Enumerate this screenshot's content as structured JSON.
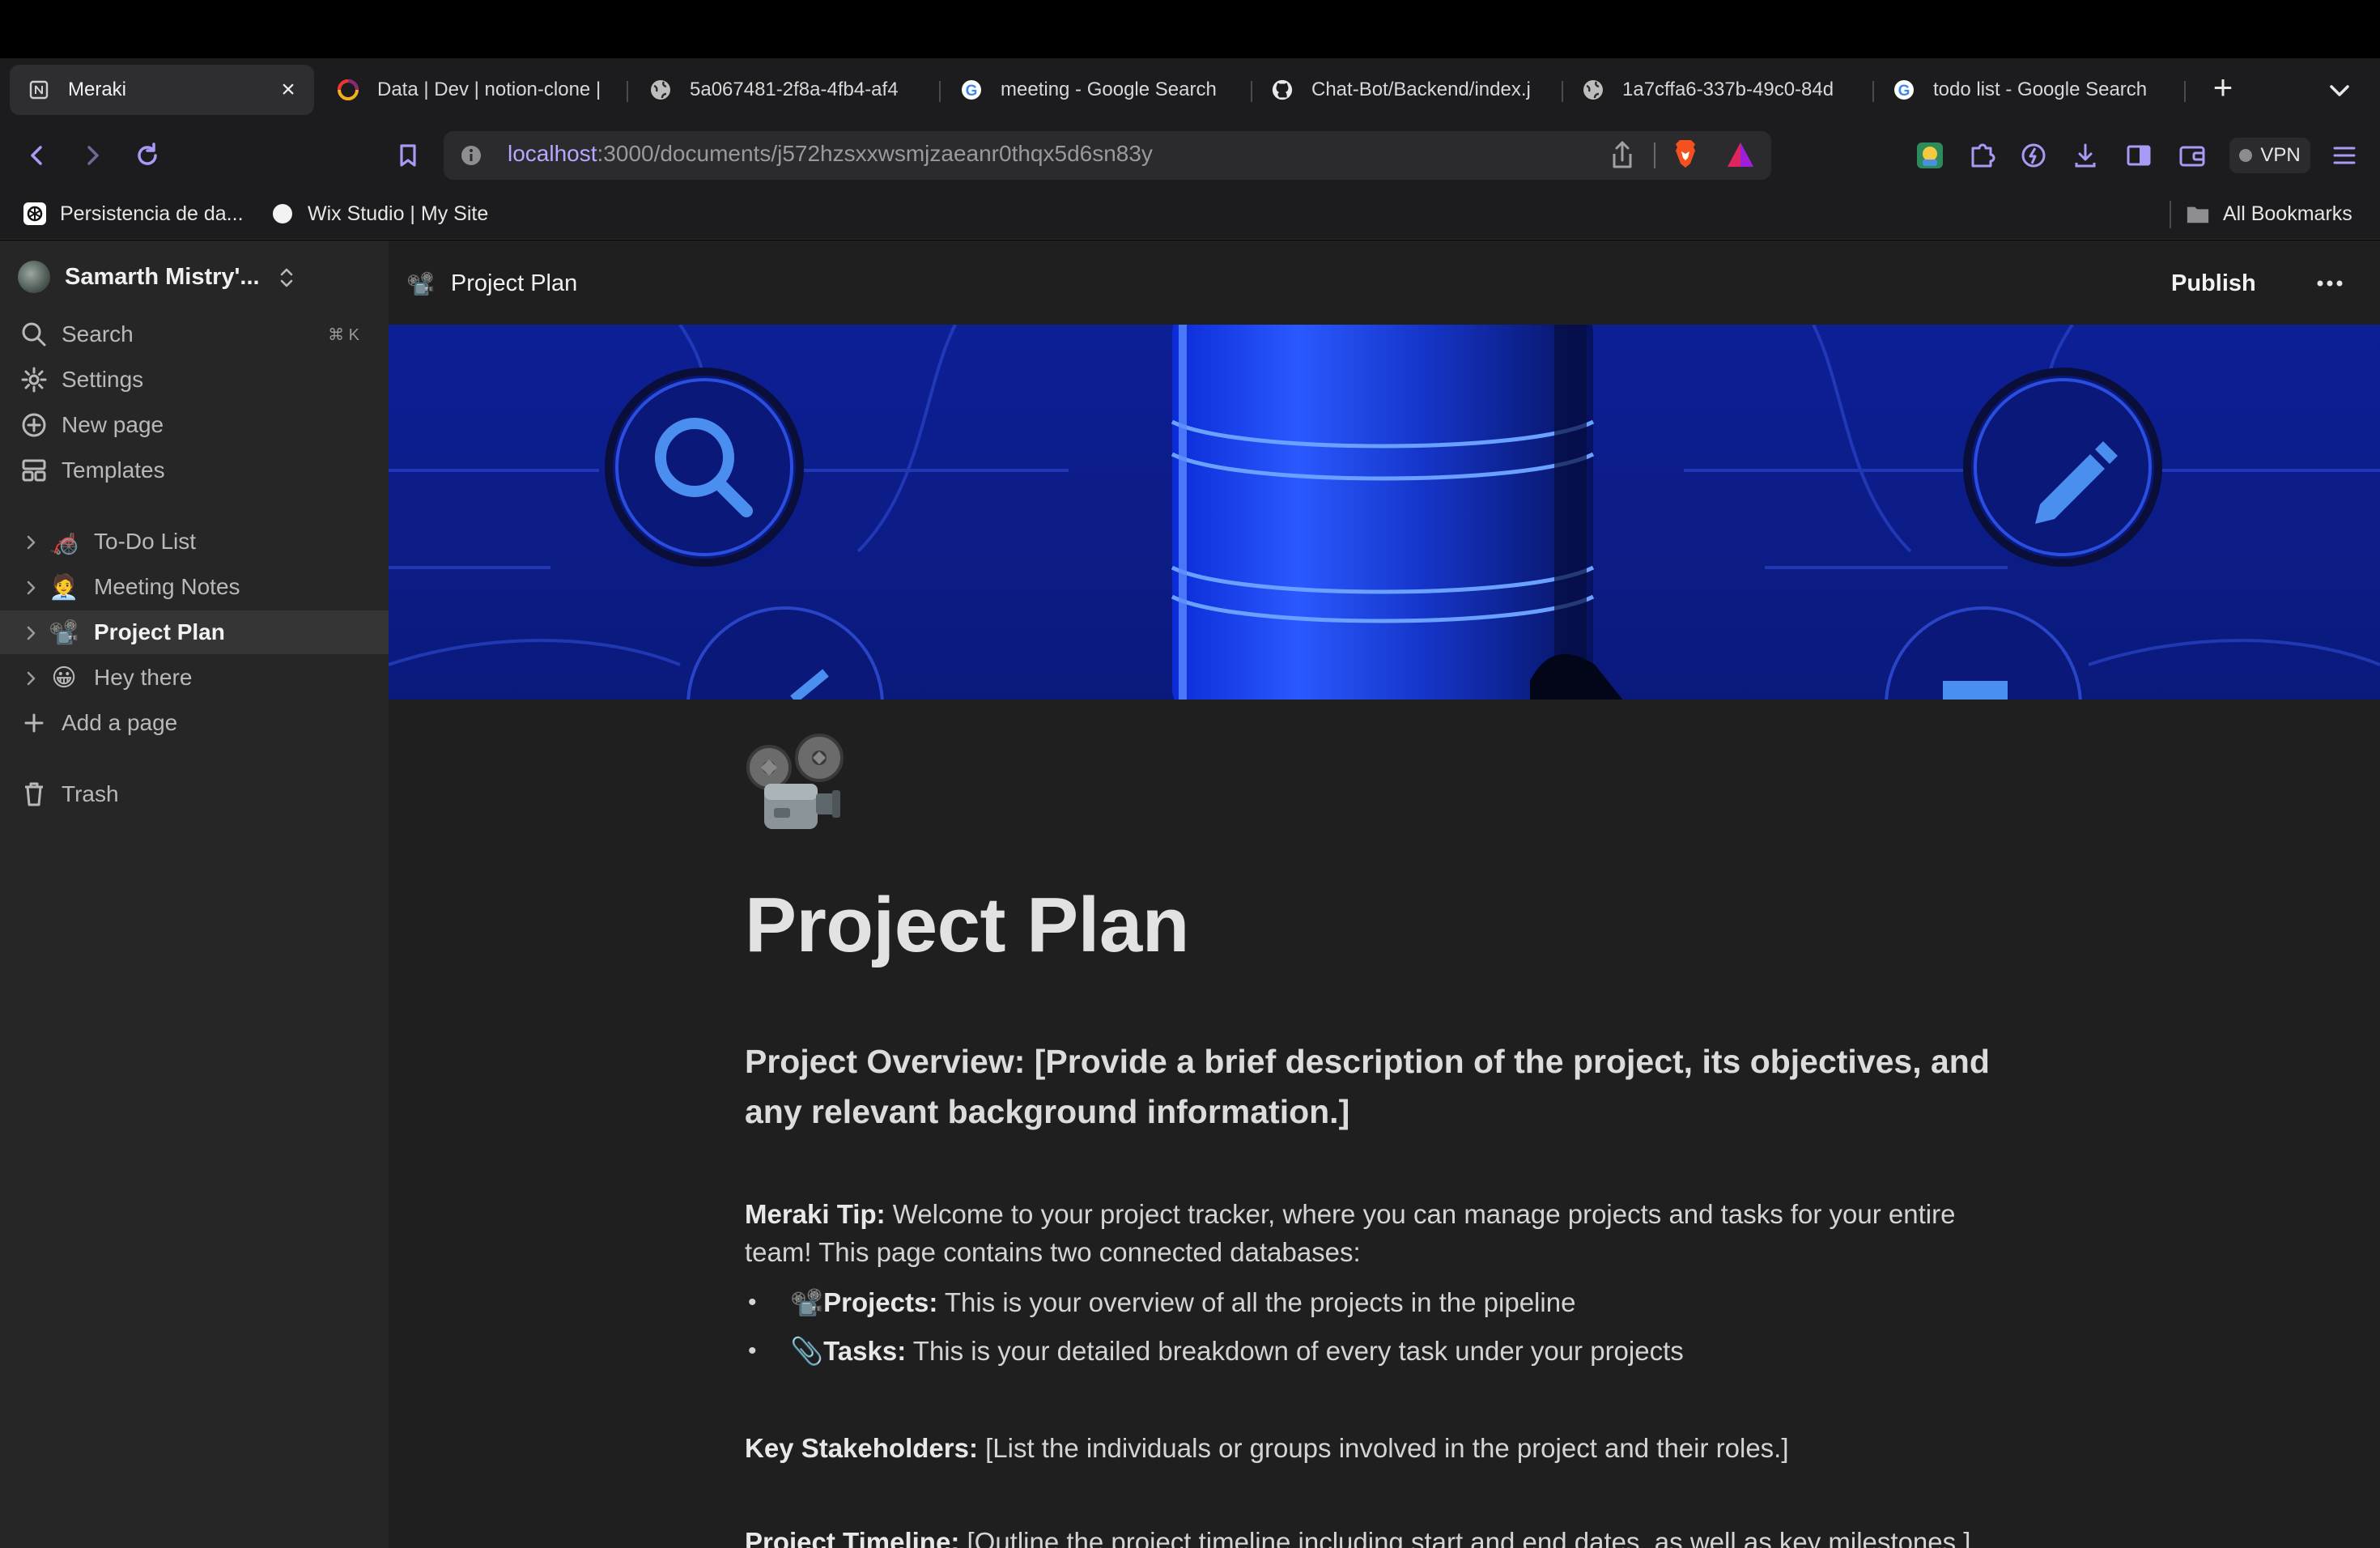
{
  "browser": {
    "tabs": [
      {
        "title": "Meraki",
        "icon": "notion-page-icon",
        "active": true
      },
      {
        "title": "Data | Dev | notion-clone |",
        "icon": "convex-logo-icon"
      },
      {
        "title": "5a067481-2f8a-4fb4-af4",
        "icon": "globe-icon"
      },
      {
        "title": "meeting - Google Search",
        "icon": "google-icon"
      },
      {
        "title": "Chat-Bot/Backend/index.j",
        "icon": "github-icon"
      },
      {
        "title": "1a7cffa6-337b-49c0-84d",
        "icon": "globe-icon"
      },
      {
        "title": "todo list - Google Search",
        "icon": "google-icon"
      }
    ],
    "close_tab": "×",
    "new_tab": "+",
    "url_host": "localhost",
    "url_path": ":3000/documents/j572hzsxxwsmjzaeanr0thqx5d6sn83y",
    "vpn_label": "VPN",
    "bookmarks": [
      {
        "label": "Persistencia de da...",
        "icon": "openai-icon"
      },
      {
        "label": "Wix Studio | My Site",
        "icon": "wix-circle-icon"
      }
    ],
    "all_bookmarks": "All Bookmarks",
    "accent": "#b9a6ff"
  },
  "sidebar": {
    "workspace_name": "Samarth Mistry'...",
    "actions": [
      {
        "label": "Search",
        "icon": "search-icon",
        "shortcut": "⌘ K"
      },
      {
        "label": "Settings",
        "icon": "gear-icon"
      },
      {
        "label": "New page",
        "icon": "plus-circle-icon"
      },
      {
        "label": "Templates",
        "icon": "templates-icon"
      }
    ],
    "documents": [
      {
        "label": "To-Do List",
        "emoji": "🦽"
      },
      {
        "label": "Meeting Notes",
        "emoji": "🧑‍💼"
      },
      {
        "label": "Project Plan",
        "emoji": "📽️",
        "selected": true
      },
      {
        "label": "Hey there",
        "emoji": "😀"
      }
    ],
    "add_page": "Add a page",
    "trash": "Trash"
  },
  "header": {
    "crumb_emoji": "📽️",
    "crumb_title": "Project Plan",
    "publish": "Publish",
    "more_icon": "ellipsis-icon"
  },
  "document": {
    "emoji": "📽️",
    "title": "Project Plan",
    "overview": "Project Overview: [Provide a brief description of the project, its objectives, and any relevant background information.]",
    "tip_label": "Meraki Tip:",
    "tip_text": " Welcome to your project tracker, where you can manage projects and tasks for your entire team! This page contains two connected databases:",
    "bullets": [
      {
        "emoji": "📽️",
        "label": "Projects:",
        "text": " This is your overview of all the projects in the pipeline"
      },
      {
        "emoji": "📎",
        "label": "Tasks:",
        "text": " This is your detailed breakdown of every task under your projects"
      }
    ],
    "stakeholders_label": "Key Stakeholders:",
    "stakeholders_text": " [List the individuals or groups involved in the project and their roles.]",
    "timeline_label": "Project Timeline:",
    "timeline_text": " [Outline the project timeline including start and end dates, as well as key milestones.]"
  }
}
